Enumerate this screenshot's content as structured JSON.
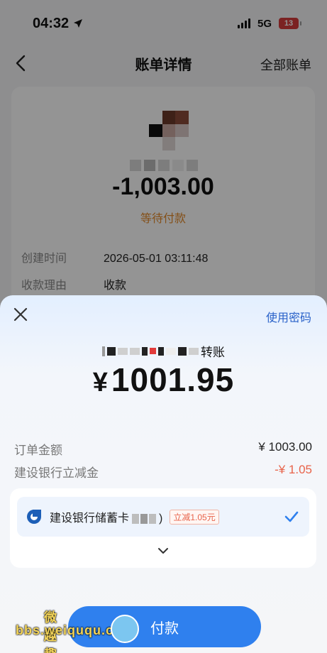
{
  "status_bar": {
    "time": "04:32",
    "network": "5G",
    "battery": "13"
  },
  "nav": {
    "title": "账单详情",
    "right_link": "全部账单"
  },
  "bill": {
    "amount": "-1,003.00",
    "status": "等待付款",
    "rows": [
      {
        "label": "创建时间",
        "value": "2026-05-01 03:11:48"
      },
      {
        "label": "收款理由",
        "value": "收款"
      }
    ]
  },
  "sheet": {
    "use_password": "使用密码",
    "payee_suffix": "转账",
    "currency": "¥",
    "pay_amount": "1001.95",
    "lines": [
      {
        "label": "订单金额",
        "value": "¥ 1003.00"
      },
      {
        "label": "建设银行立减金",
        "value": "-¥ 1.05"
      }
    ],
    "method": {
      "bank_name": "建设银行储蓄卡",
      "closing": ")",
      "promo": "立减1.05元"
    },
    "pay_button": "付款"
  },
  "watermark": {
    "line1": "微趣趣",
    "line2": "bbs.weiququ.cn"
  },
  "colors": {
    "accent": "#2f80ee",
    "discount": "#e8634a",
    "pending": "#e38b2c"
  }
}
